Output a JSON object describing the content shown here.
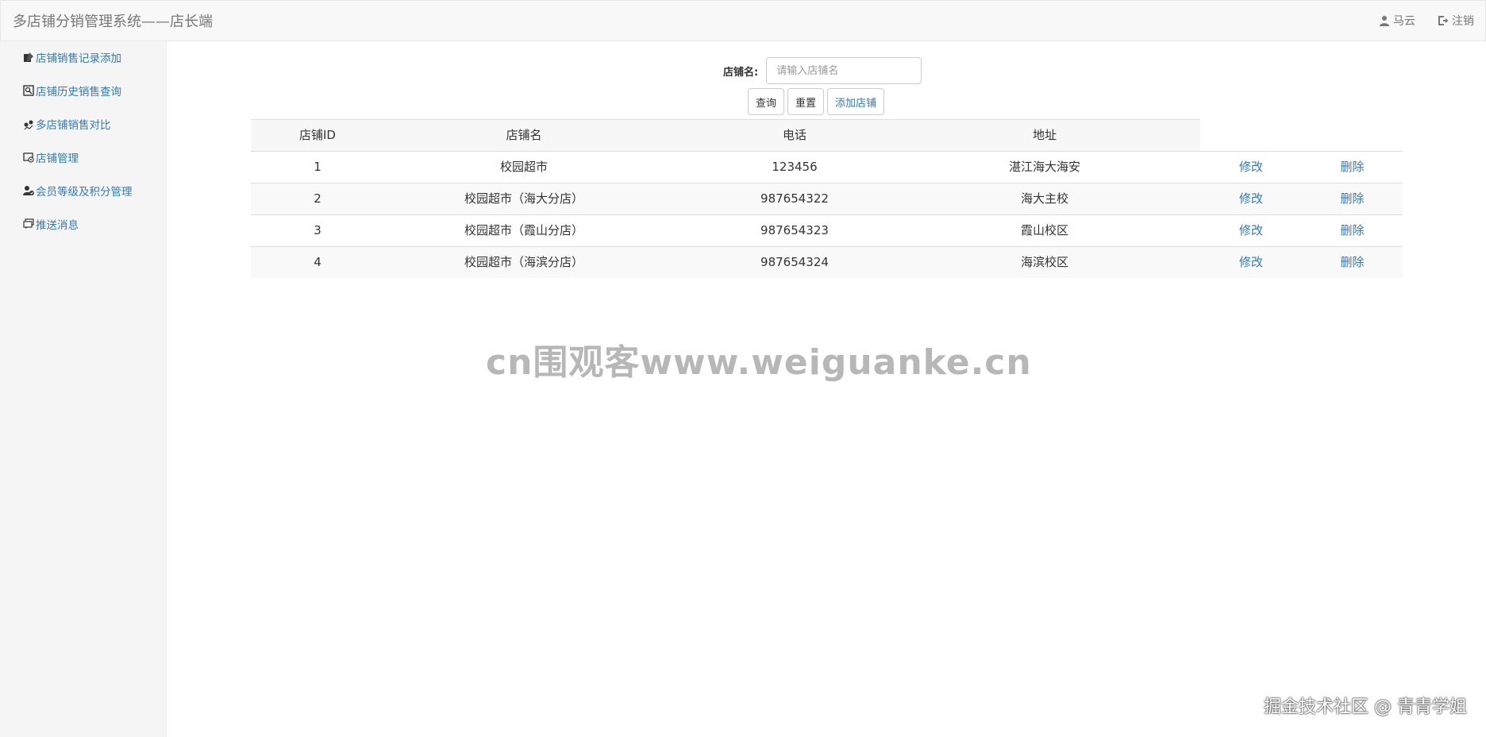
{
  "header": {
    "title": "多店铺分销管理系统——店长端",
    "user_name": "马云",
    "logout_label": "注销"
  },
  "sidebar": {
    "items": [
      {
        "label": "店铺销售记录添加",
        "icon": "edit-icon"
      },
      {
        "label": "店铺历史销售查询",
        "icon": "search-history-icon"
      },
      {
        "label": "多店铺销售对比",
        "icon": "compare-icon"
      },
      {
        "label": "店铺管理",
        "icon": "shop-settings-icon"
      },
      {
        "label": "会员等级及积分管理",
        "icon": "member-icon"
      },
      {
        "label": "推送消息",
        "icon": "message-icon"
      }
    ]
  },
  "search": {
    "label": "店铺名:",
    "placeholder": "请输入店铺名",
    "value": "",
    "query_label": "查询",
    "reset_label": "重置",
    "add_label": "添加店铺"
  },
  "table": {
    "headers": [
      "店铺ID",
      "店铺名",
      "电话",
      "地址"
    ],
    "rows": [
      {
        "id": "1",
        "name": "校园超市",
        "phone": "123456",
        "address": "湛江海大海安",
        "edit": "修改",
        "delete": "删除"
      },
      {
        "id": "2",
        "name": "校园超市（海大分店）",
        "phone": "987654322",
        "address": "海大主校",
        "edit": "修改",
        "delete": "删除"
      },
      {
        "id": "3",
        "name": "校园超市（霞山分店）",
        "phone": "987654323",
        "address": "霞山校区",
        "edit": "修改",
        "delete": "删除"
      },
      {
        "id": "4",
        "name": "校园超市（海滨分店）",
        "phone": "987654324",
        "address": "海滨校区",
        "edit": "修改",
        "delete": "删除"
      }
    ]
  },
  "watermarks": {
    "center": "cn围观客www.weiguanke.cn",
    "corner": "掘金技术社区 @ 青青学姐"
  },
  "colors": {
    "link": "#337ab7",
    "navbar_bg": "#f8f8f8",
    "sidebar_bg": "#f5f5f5",
    "border": "#dddddd"
  }
}
